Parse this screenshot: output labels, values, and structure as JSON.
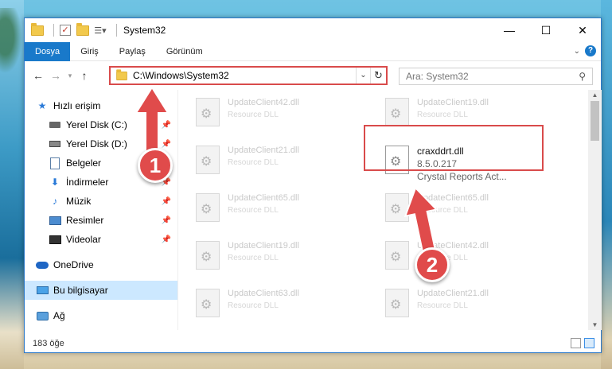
{
  "window": {
    "title": "System32"
  },
  "ribbon": {
    "tabs": [
      "Dosya",
      "Giriş",
      "Paylaş",
      "Görünüm"
    ]
  },
  "address": {
    "path": "C:\\Windows\\System32"
  },
  "search": {
    "placeholder": "Ara: System32"
  },
  "sidebar": {
    "quick_access": "Hızlı erişim",
    "items": [
      {
        "label": "Yerel Disk (C:)",
        "icon": "drive-icon",
        "pinned": true
      },
      {
        "label": "Yerel Disk (D:)",
        "icon": "drive-icon",
        "pinned": true
      },
      {
        "label": "Belgeler",
        "icon": "documents-icon",
        "pinned": true
      },
      {
        "label": "İndirmeler",
        "icon": "downloads-icon",
        "pinned": true
      },
      {
        "label": "Müzik",
        "icon": "music-icon",
        "pinned": true
      },
      {
        "label": "Resimler",
        "icon": "pictures-icon",
        "pinned": true
      },
      {
        "label": "Videolar",
        "icon": "videos-icon",
        "pinned": true
      }
    ],
    "onedrive": "OneDrive",
    "this_pc": "Bu bilgisayar",
    "network": "Ağ"
  },
  "files": {
    "left_column": [
      {
        "name": "UpdateClient42.dll",
        "desc": "Resource DLL"
      },
      {
        "name": "UpdateClient21.dll",
        "desc": "Resource DLL"
      },
      {
        "name": "UpdateClient65.dll",
        "desc": "Resource DLL"
      },
      {
        "name": "UpdateClient19.dll",
        "desc": "Resource DLL"
      },
      {
        "name": "UpdateClient63.dll",
        "desc": "Resource DLL"
      }
    ],
    "right_column": [
      {
        "name": "UpdateClient19.dll",
        "desc": "Resource DLL"
      },
      {
        "name": "UpdateClient65.dll",
        "desc": "Resource DLL"
      },
      {
        "name": "UpdateClient42.dll",
        "desc": "Resource DLL"
      },
      {
        "name": "UpdateClient21.dll",
        "desc": "Resource DLL"
      }
    ],
    "highlighted": {
      "name": "craxddrt.dll",
      "version": "8.5.0.217",
      "desc": "Crystal Reports Act..."
    }
  },
  "status": {
    "count": "183 öğe"
  },
  "markers": {
    "one": "1",
    "two": "2"
  },
  "colors": {
    "accent": "#1979ca",
    "highlight_red": "#d94b4b",
    "selection": "#cce8ff"
  }
}
